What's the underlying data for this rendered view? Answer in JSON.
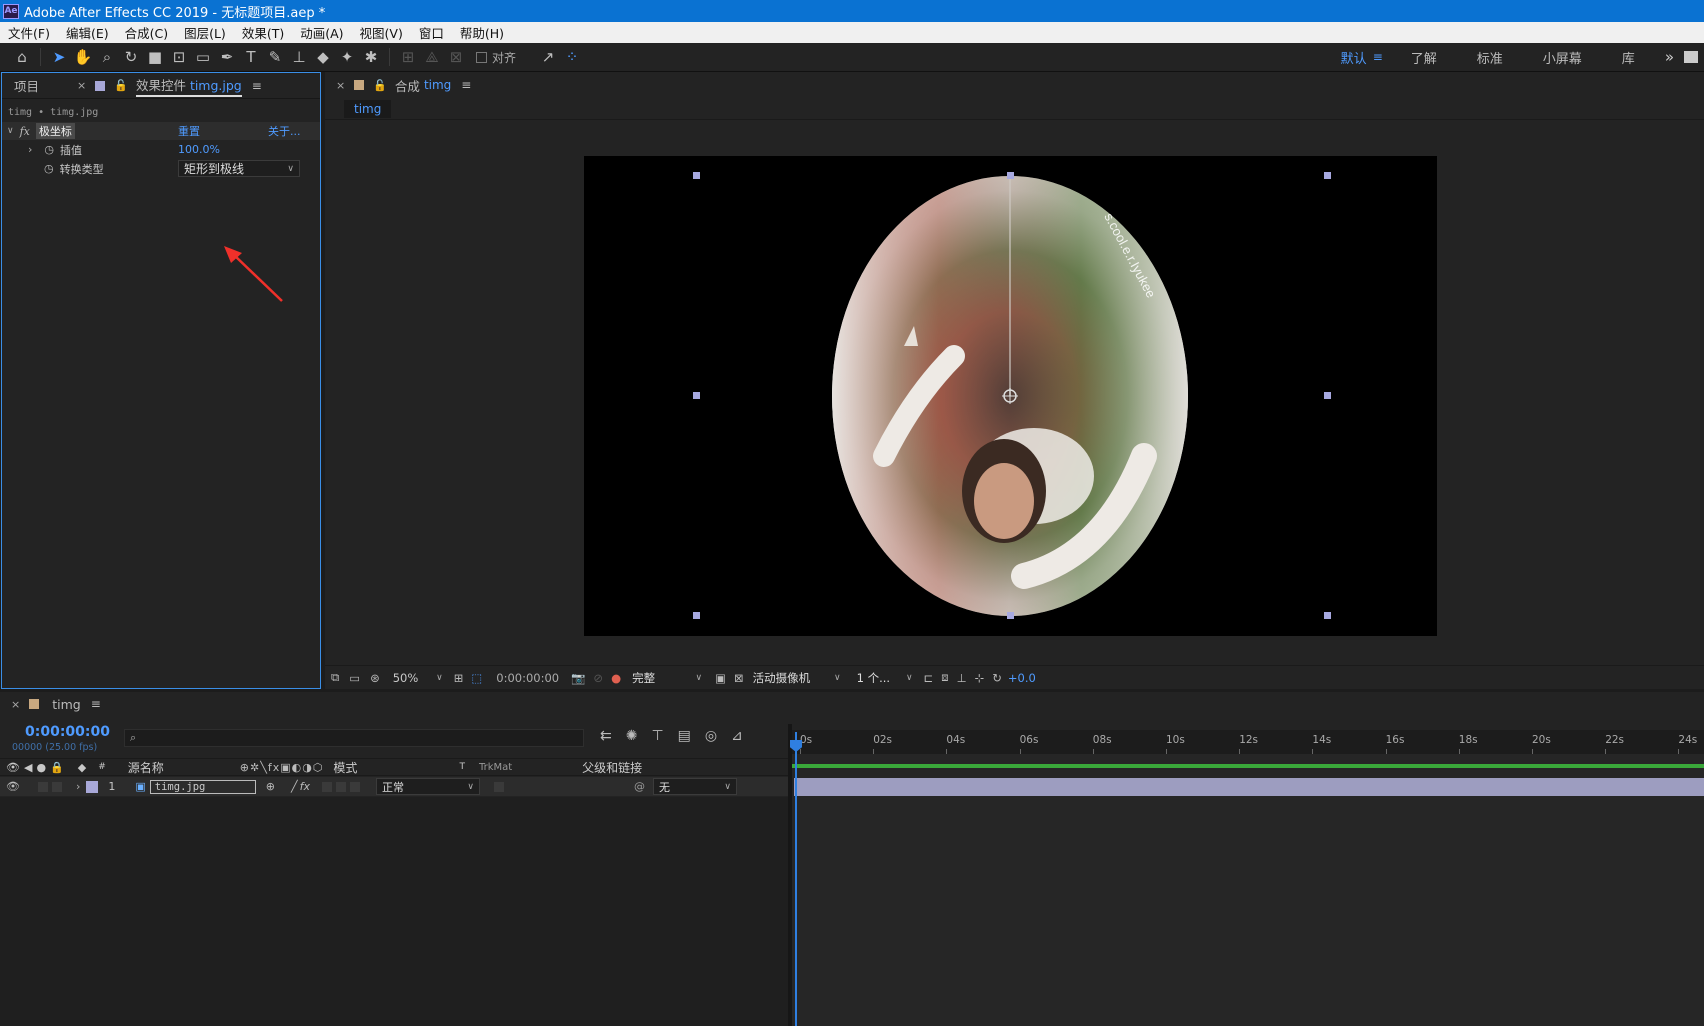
{
  "window": {
    "title": "Adobe After Effects CC 2019 - 无标题项目.aep *",
    "logo": "Ae"
  },
  "menu": [
    "文件(F)",
    "编辑(E)",
    "合成(C)",
    "图层(L)",
    "效果(T)",
    "动画(A)",
    "视图(V)",
    "窗口",
    "帮助(H)"
  ],
  "toolbar": {
    "align_label": "对齐",
    "workspaces": [
      "默认",
      "了解",
      "标准",
      "小屏幕",
      "库"
    ],
    "active_workspace": "默认"
  },
  "project_panel": {
    "tab_project": "项目",
    "tab_effects": "效果控件",
    "tab_effects_layer": "timg.jpg",
    "breadcrumb": "timg • timg.jpg",
    "effect": {
      "name": "极坐标",
      "reset": "重置",
      "about": "关于...",
      "params": [
        {
          "label": "插值",
          "value": "100.0%"
        },
        {
          "label": "转换类型",
          "value": "矩形到极线"
        }
      ]
    }
  },
  "comp_panel": {
    "tab_prefix": "合成",
    "tab_name": "timg",
    "subtab": "timg",
    "watermark": "s.cool.e.r.Iyukee",
    "footer": {
      "zoom": "50%",
      "timecode": "0:00:00:00",
      "resolution": "完整",
      "camera": "活动摄像机",
      "views": "1 个...",
      "exposure": "+0.0"
    }
  },
  "timeline": {
    "tab_name": "timg",
    "current_time": "0:00:00:00",
    "frame_info": "00000 (25.00 fps)",
    "search_placeholder": "",
    "columns": {
      "num": "#",
      "source": "源名称",
      "mode": "模式",
      "t": "T",
      "trkmat": "TrkMat",
      "parent": "父级和链接"
    },
    "ruler": [
      "0s",
      "02s",
      "04s",
      "06s",
      "08s",
      "10s",
      "12s",
      "14s",
      "16s",
      "18s",
      "20s",
      "22s",
      "24s"
    ],
    "layers": [
      {
        "num": "1",
        "name": "timg.jpg",
        "mode": "正常",
        "parent": "无"
      }
    ]
  },
  "colors": {
    "accent": "#4f9bff",
    "titlebar": "#0a72d2",
    "annotation_arrow": "#f0302a",
    "layer_bar": "#9d9dc0"
  }
}
